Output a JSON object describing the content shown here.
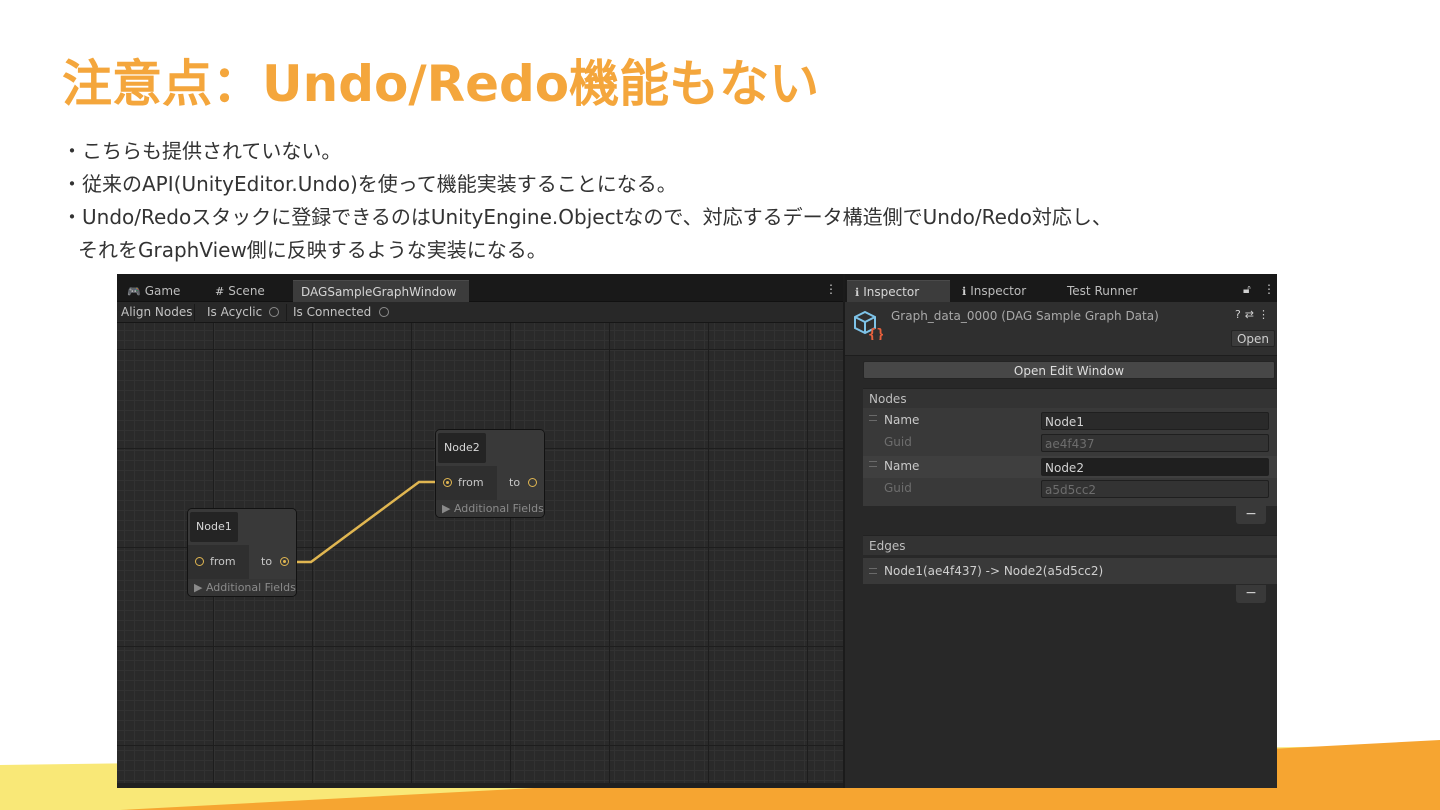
{
  "slide": {
    "title": "注意点：Undo/Redo機能もない",
    "bullets": [
      "・こちらも提供されていない。",
      "・従来のAPI(UnityEditor.Undo)を使って機能実装することになる。",
      "・Undo/Redoスタックに登録できるのはUnityEngine.Objectなので、対応するデータ構造側でUndo/Redo対応し、",
      "それをGraphView側に反映するような実装になる。"
    ]
  },
  "colors": {
    "accent": "#f4a63c",
    "edge": "#e0b651",
    "editor_bg": "#202020"
  },
  "editor": {
    "left_tabs": [
      {
        "icon": "game-controller-icon",
        "glyph": "🎮",
        "label": "Game"
      },
      {
        "icon": "scene-grid-icon",
        "glyph": "#",
        "label": "Scene"
      },
      {
        "icon": "",
        "glyph": "",
        "label": "DAGSampleGraphWindow"
      }
    ],
    "toolbar": {
      "align_label": "Align Nodes",
      "acyclic_label": "Is Acyclic",
      "connected_label": "Is Connected"
    },
    "nodes": [
      {
        "title": "Node2",
        "in_label": "from",
        "out_label": "to",
        "footer": "Additional Fields"
      },
      {
        "title": "Node1",
        "in_label": "from",
        "out_label": "to",
        "footer": "Additional Fields"
      }
    ],
    "right_tabs": [
      {
        "icon": "info-icon",
        "glyph": "ℹ",
        "label": "Inspector"
      },
      {
        "icon": "info-icon",
        "glyph": "ℹ",
        "label": "Inspector"
      },
      {
        "icon": "",
        "glyph": "",
        "label": "Test Runner"
      }
    ],
    "inspector": {
      "asset_name": "Graph_data_0000 (DAG Sample Graph Data)",
      "open_label": "Open",
      "edit_window_label": "Open Edit Window",
      "nodes_header": "Nodes",
      "node_entries": [
        {
          "name_label": "Name",
          "name_value": "Node1",
          "guid_label": "Guid",
          "guid_value": "ae4f437"
        },
        {
          "name_label": "Name",
          "name_value": "Node2",
          "guid_label": "Guid",
          "guid_value": "a5d5cc2"
        }
      ],
      "edges_header": "Edges",
      "edges": [
        "Node1(ae4f437) -> Node2(a5d5cc2)"
      ],
      "minus_label": "−"
    }
  }
}
